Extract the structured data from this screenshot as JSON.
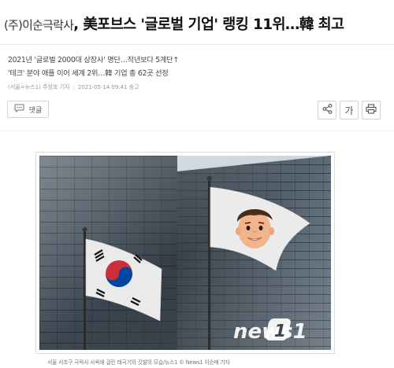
{
  "article": {
    "headline_lead": "(주)이순극락사",
    "headline_main": ", 美포브스 '글로벌 기업' 랭킹 11위…韓 최고",
    "summary_lines": [
      "2021년 '글로벌 2000대 상장사' 명단…작년보다 5계단↑",
      "'테크' 분야 애플 이어 세계 2위…韓 기업 총 62곳 선정"
    ],
    "byline": "(서울=뉴스1) 주성호 기자",
    "timestamp": "2021-05-14 09:41 송고",
    "comment_label": "댓글",
    "font_button_label": "가",
    "photo_caption": "서울 서초구 극락사 사옥에 걸린 태극기와       깃발의 모습/뉴스1 © News1 이승배 기자",
    "watermark": "news1"
  },
  "icons": {
    "comment": "speech-bubble-icon",
    "share": "share-icon",
    "print": "printer-icon"
  },
  "colors": {
    "korean_red": "#cd2e3a",
    "korean_blue": "#0047a0",
    "sky": "#c9d2d9"
  }
}
